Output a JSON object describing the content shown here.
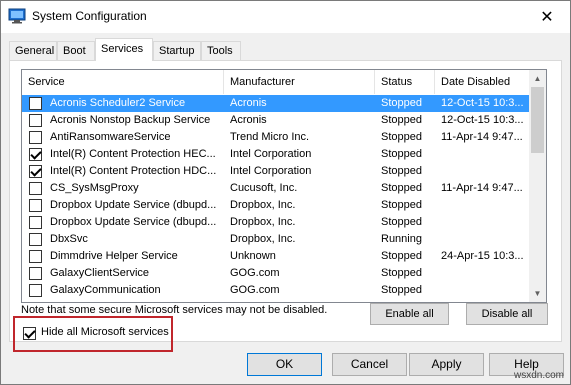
{
  "window": {
    "title": "System Configuration",
    "close_glyph": "✕"
  },
  "tabs": [
    {
      "label": "General"
    },
    {
      "label": "Boot"
    },
    {
      "label": "Services",
      "active": true
    },
    {
      "label": "Startup"
    },
    {
      "label": "Tools"
    }
  ],
  "table": {
    "headers": [
      "Service",
      "Manufacturer",
      "Status",
      "Date Disabled"
    ],
    "rows": [
      {
        "checked": false,
        "service": "Acronis Scheduler2 Service",
        "manufacturer": "Acronis",
        "status": "Stopped",
        "date": "12-Oct-15 10:3...",
        "selected": true
      },
      {
        "checked": false,
        "service": "Acronis Nonstop Backup Service",
        "manufacturer": "Acronis",
        "status": "Stopped",
        "date": "12-Oct-15 10:3..."
      },
      {
        "checked": false,
        "service": "AntiRansomwareService",
        "manufacturer": "Trend Micro Inc.",
        "status": "Stopped",
        "date": "11-Apr-14 9:47..."
      },
      {
        "checked": true,
        "service": "Intel(R) Content Protection HEC...",
        "manufacturer": "Intel Corporation",
        "status": "Stopped",
        "date": ""
      },
      {
        "checked": true,
        "service": "Intel(R) Content Protection HDC...",
        "manufacturer": "Intel Corporation",
        "status": "Stopped",
        "date": ""
      },
      {
        "checked": false,
        "service": "CS_SysMsgProxy",
        "manufacturer": "Cucusoft, Inc.",
        "status": "Stopped",
        "date": "11-Apr-14 9:47..."
      },
      {
        "checked": false,
        "service": "Dropbox Update Service (dbupd...",
        "manufacturer": "Dropbox, Inc.",
        "status": "Stopped",
        "date": ""
      },
      {
        "checked": false,
        "service": "Dropbox Update Service (dbupd...",
        "manufacturer": "Dropbox, Inc.",
        "status": "Stopped",
        "date": ""
      },
      {
        "checked": false,
        "service": "DbxSvc",
        "manufacturer": "Dropbox, Inc.",
        "status": "Running",
        "date": ""
      },
      {
        "checked": false,
        "service": "Dimmdrive Helper Service",
        "manufacturer": "Unknown",
        "status": "Stopped",
        "date": "24-Apr-15 10:3..."
      },
      {
        "checked": false,
        "service": "GalaxyClientService",
        "manufacturer": "GOG.com",
        "status": "Stopped",
        "date": ""
      },
      {
        "checked": false,
        "service": "GalaxyCommunication",
        "manufacturer": "GOG.com",
        "status": "Stopped",
        "date": ""
      }
    ]
  },
  "note": "Note that some secure Microsoft services may not be disabled.",
  "buttons": {
    "enable_all": "Enable all",
    "disable_all": "Disable all",
    "ok": "OK",
    "cancel": "Cancel",
    "apply": "Apply",
    "help": "Help"
  },
  "hide_ms": {
    "label": "Hide all Microsoft services",
    "checked": true
  },
  "colors": {
    "selection": "#3399ff",
    "highlight_box": "#c0262c"
  },
  "watermark": "wsxdn.com",
  "icons": {
    "app": "system-configuration-icon",
    "scroll_up": "chevron-up-icon",
    "scroll_down": "chevron-down-icon"
  }
}
